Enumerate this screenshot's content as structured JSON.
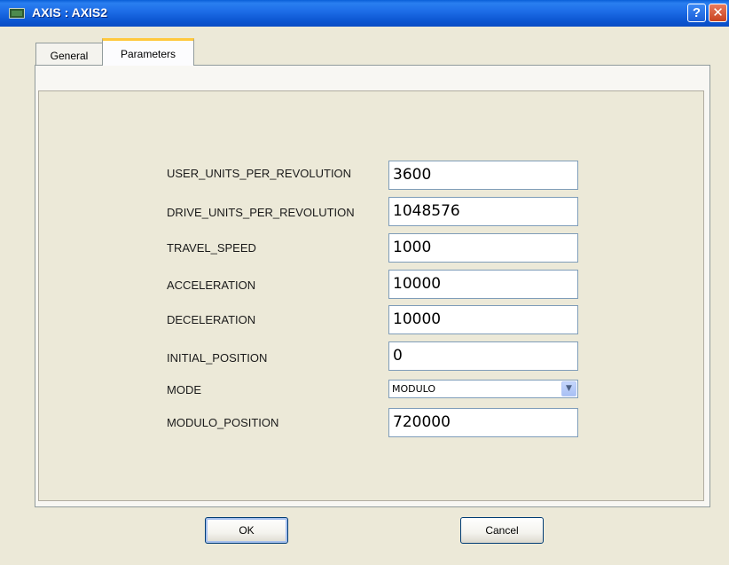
{
  "window": {
    "title": "AXIS : AXIS2",
    "help_label": "?",
    "close_label": "✕"
  },
  "tabs": [
    {
      "label": "General",
      "active": false
    },
    {
      "label": "Parameters",
      "active": true
    }
  ],
  "fields": [
    {
      "label": "USER_UNITS_PER_REVOLUTION",
      "value": "3600"
    },
    {
      "label": "DRIVE_UNITS_PER_REVOLUTION",
      "value": "1048576"
    },
    {
      "label": "TRAVEL_SPEED",
      "value": "1000"
    },
    {
      "label": "ACCELERATION",
      "value": "10000"
    },
    {
      "label": "DECELERATION",
      "value": "10000"
    },
    {
      "label": "INITIAL_POSITION",
      "value": "0"
    },
    {
      "label": "MODE",
      "value": "MODULO"
    },
    {
      "label": "MODULO_POSITION",
      "value": "720000"
    }
  ],
  "buttons": {
    "ok": "OK",
    "cancel": "Cancel"
  },
  "icons": {
    "app": "window-app-icon",
    "dropdown": "chevron-down-icon"
  },
  "colors": {
    "titlebar": "#0a55d0",
    "dialog_background": "#ece9d8",
    "tab_highlight": "#ffc83c"
  }
}
